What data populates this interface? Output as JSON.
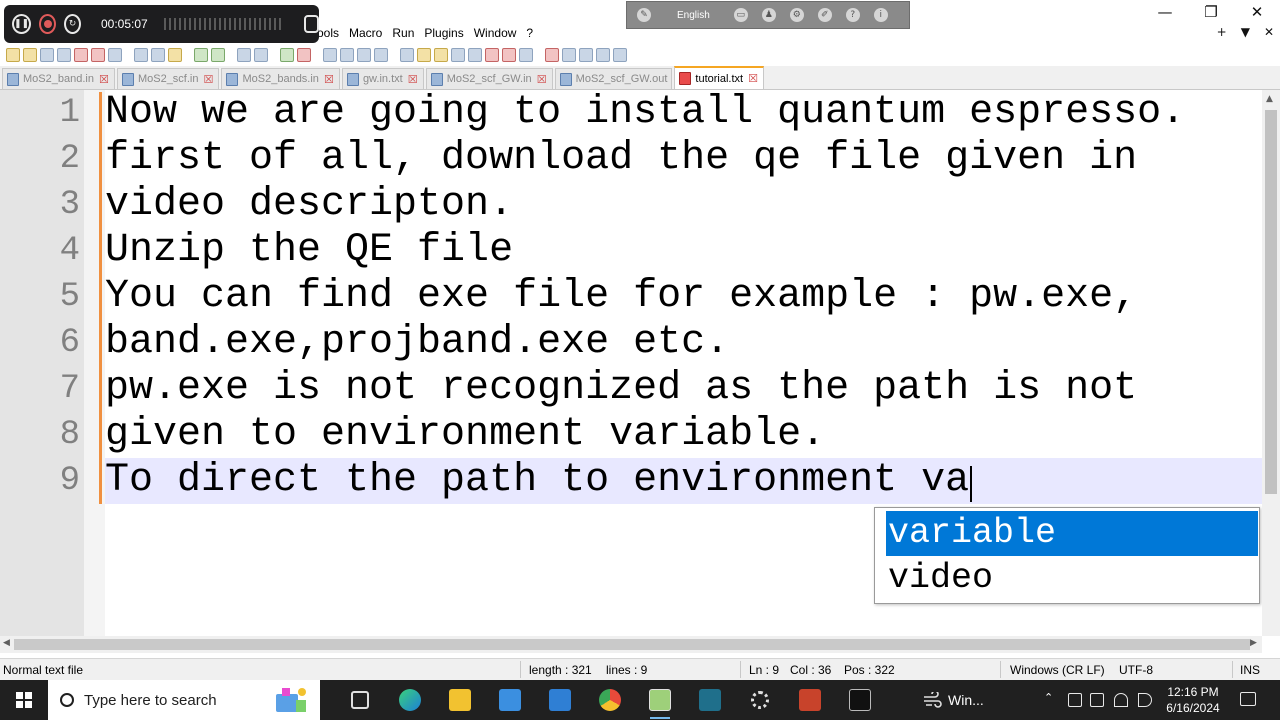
{
  "menu": [
    "ools",
    "Macro",
    "Run",
    "Plugins",
    "Window",
    "?"
  ],
  "window_controls": {
    "minimize": "—",
    "restore": "❐",
    "close": "✕",
    "mini_plus": "+",
    "mini_down": "▼",
    "mini_close": "✕"
  },
  "recorder": {
    "time": "00:05:07"
  },
  "language_bar": {
    "label": "English"
  },
  "tabs": [
    {
      "label": "MoS2_band.in",
      "active": false
    },
    {
      "label": "MoS2_scf.in",
      "active": false
    },
    {
      "label": "MoS2_bands.in",
      "active": false
    },
    {
      "label": "gw.in.txt",
      "active": false
    },
    {
      "label": "MoS2_scf_GW.in",
      "active": false
    },
    {
      "label": "MoS2_scf_GW.out",
      "active": false
    },
    {
      "label": "tutorial.txt",
      "active": true
    }
  ],
  "editor": {
    "lines": [
      "Now we are going to install quantum espresso.",
      "first of all, download the qe file given in",
      "video descripton.",
      "Unzip the QE file",
      "You can find exe file for example : pw.exe,",
      "band.exe,projband.exe etc.",
      "pw.exe is not recognized as the path is not",
      "given to environment variable.",
      "To direct the path to environment va"
    ],
    "line_numbers": [
      "1",
      "2",
      "3",
      "4",
      "5",
      "6",
      "7",
      "8",
      "9"
    ],
    "current_line": 9
  },
  "autocomplete": {
    "items": [
      "variable",
      "video"
    ],
    "selected": 0
  },
  "statusbar": {
    "file_type": "Normal text file",
    "length": "length : 321",
    "lines": "lines : 9",
    "ln": "Ln : 9",
    "col": "Col : 36",
    "pos": "Pos : 322",
    "eol": "Windows (CR LF)",
    "encoding": "UTF-8",
    "mode": "INS"
  },
  "taskbar": {
    "search_placeholder": "Type here to search",
    "weather_label": "Win...",
    "time": "12:16 PM",
    "date": "6/16/2024"
  },
  "colors": {
    "current_line": "#e8e8ff",
    "selection": "#0078d7",
    "active_tab_accent": "#f5a623",
    "change_bar": "#f09040",
    "taskbar": "#202020"
  }
}
